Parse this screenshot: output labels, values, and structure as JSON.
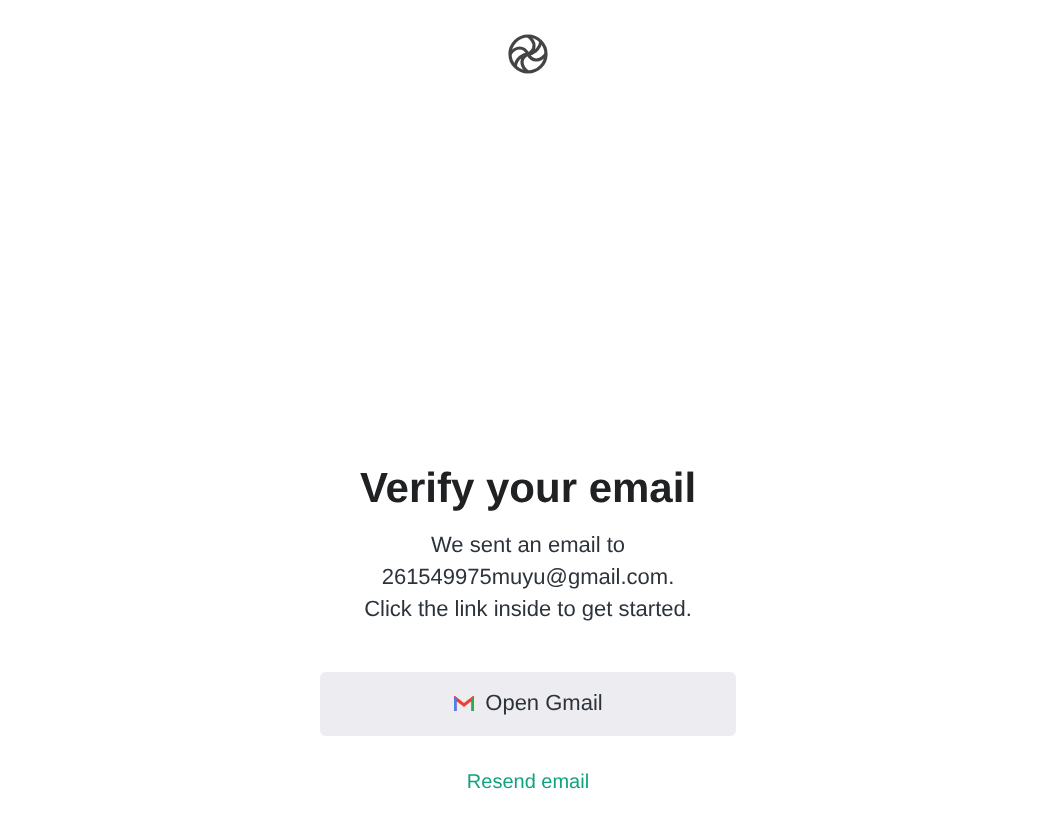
{
  "heading": "Verify your email",
  "message_lines": [
    "We sent an email to",
    "261549975muyu@gmail.com.",
    "Click the link inside to get started."
  ],
  "primary_button": {
    "label": "Open Gmail"
  },
  "resend_link": "Resend email"
}
